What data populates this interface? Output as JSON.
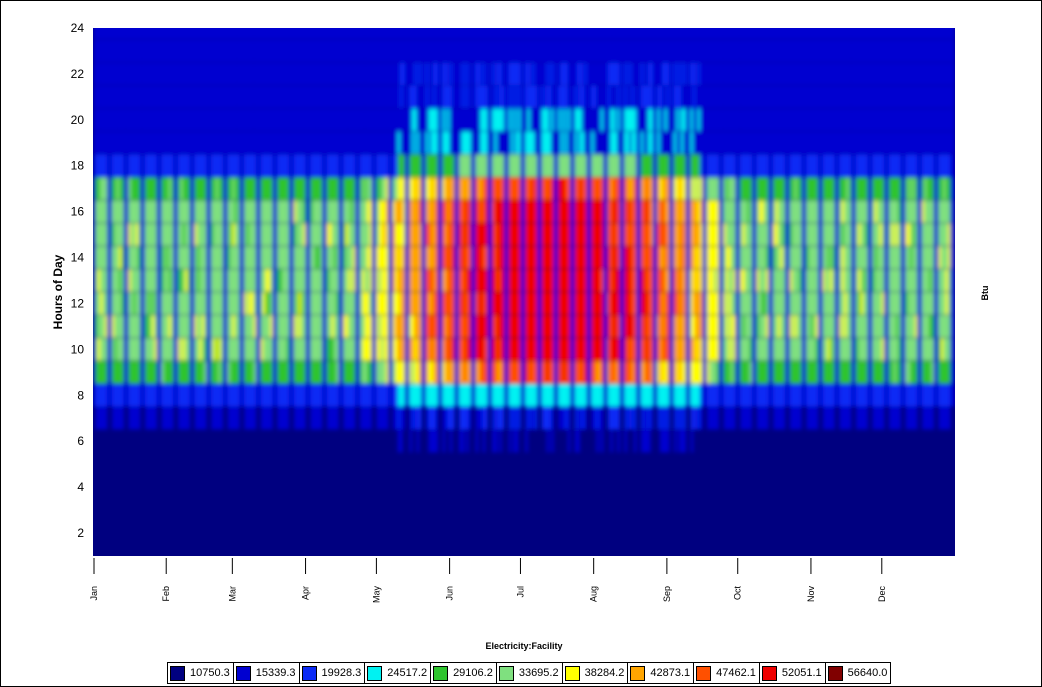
{
  "chart_data": {
    "type": "heatmap",
    "title": "",
    "xlabel": "Electricity:Facility",
    "ylabel": "Hours of Day",
    "zlabel": "Btu",
    "x_range_days": [
      0,
      365
    ],
    "ylim": [
      1,
      24
    ],
    "y_ticks": [
      "2",
      "4",
      "6",
      "8",
      "10",
      "12",
      "14",
      "16",
      "18",
      "20",
      "22",
      "24"
    ],
    "x_ticks": [
      "Jan",
      "Feb",
      "Mar",
      "Apr",
      "May",
      "Jun",
      "Jul",
      "Aug",
      "Sep",
      "Oct",
      "Nov",
      "Dec"
    ],
    "legend_position": "bottom",
    "levels": [
      {
        "value": "10750.3",
        "color": "#000080"
      },
      {
        "value": "15339.3",
        "color": "#0000d0"
      },
      {
        "value": "19928.3",
        "color": "#0a2af5"
      },
      {
        "value": "24517.2",
        "color": "#00f2f2"
      },
      {
        "value": "29106.2",
        "color": "#2ec42e"
      },
      {
        "value": "33695.2",
        "color": "#7fe07f"
      },
      {
        "value": "38284.2",
        "color": "#ffff00"
      },
      {
        "value": "42873.1",
        "color": "#ffa500"
      },
      {
        "value": "47462.1",
        "color": "#ff5000"
      },
      {
        "value": "52051.1",
        "color": "#ee0000"
      },
      {
        "value": "56640.0",
        "color": "#800000"
      }
    ],
    "daily_pattern": {
      "night_hours": "1-5",
      "night_value": 10750.3,
      "weekend_value": 15339.3,
      "weekday_occupied_hours": "8-18",
      "weekday_occupied_value_winter": 33695.2,
      "weekday_occupied_value_summer": 52051.1,
      "summer_peak_months": [
        "Jun",
        "Jul",
        "Aug"
      ]
    }
  }
}
